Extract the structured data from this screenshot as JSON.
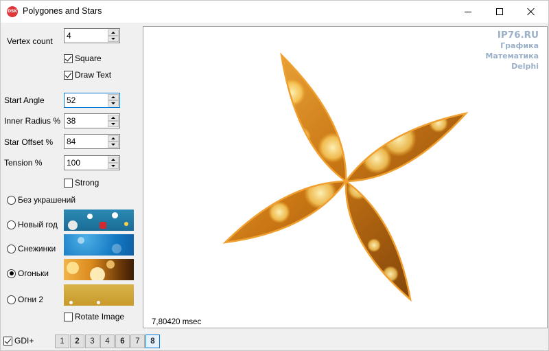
{
  "window": {
    "title": "Polygones and Stars",
    "icon_text": "OSK"
  },
  "controls": {
    "vertex_count": {
      "label": "Vertex count",
      "value": "4"
    },
    "square": {
      "label": "Square",
      "checked": true
    },
    "draw_text": {
      "label": "Draw Text",
      "checked": true
    },
    "start_angle": {
      "label": "Start Angle",
      "value": "52"
    },
    "inner_radius": {
      "label": "Inner Radius %",
      "value": "38"
    },
    "star_offset": {
      "label": "Star Offset %",
      "value": "84"
    },
    "tension": {
      "label": "Tension %",
      "value": "100"
    },
    "strong": {
      "label": "Strong",
      "checked": false
    }
  },
  "decorations": [
    {
      "label": "Без украшений",
      "selected": false
    },
    {
      "label": "Новый год",
      "selected": false
    },
    {
      "label": "Снежинки",
      "selected": false
    },
    {
      "label": "Огоньки",
      "selected": true
    },
    {
      "label": "Огни 2",
      "selected": false
    }
  ],
  "rotate_image": {
    "label": "Rotate Image",
    "checked": false
  },
  "gdi_plus": {
    "label": "GDI+",
    "checked": true
  },
  "number_buttons": [
    {
      "label": "1",
      "bold": false,
      "active": false
    },
    {
      "label": "2",
      "bold": true,
      "active": false
    },
    {
      "label": "3",
      "bold": false,
      "active": false
    },
    {
      "label": "4",
      "bold": false,
      "active": false
    },
    {
      "label": "6",
      "bold": true,
      "active": false
    },
    {
      "label": "7",
      "bold": false,
      "active": false
    },
    {
      "label": "8",
      "bold": true,
      "active": true
    }
  ],
  "canvas": {
    "watermark": [
      "IP76.RU",
      "Графика",
      "Математика",
      "Delphi"
    ],
    "timing": "7,80420 msec"
  },
  "colors": {
    "accent": "#0078d7",
    "watermark": "#9bb0c8",
    "petal_outline": "#f0a030"
  }
}
